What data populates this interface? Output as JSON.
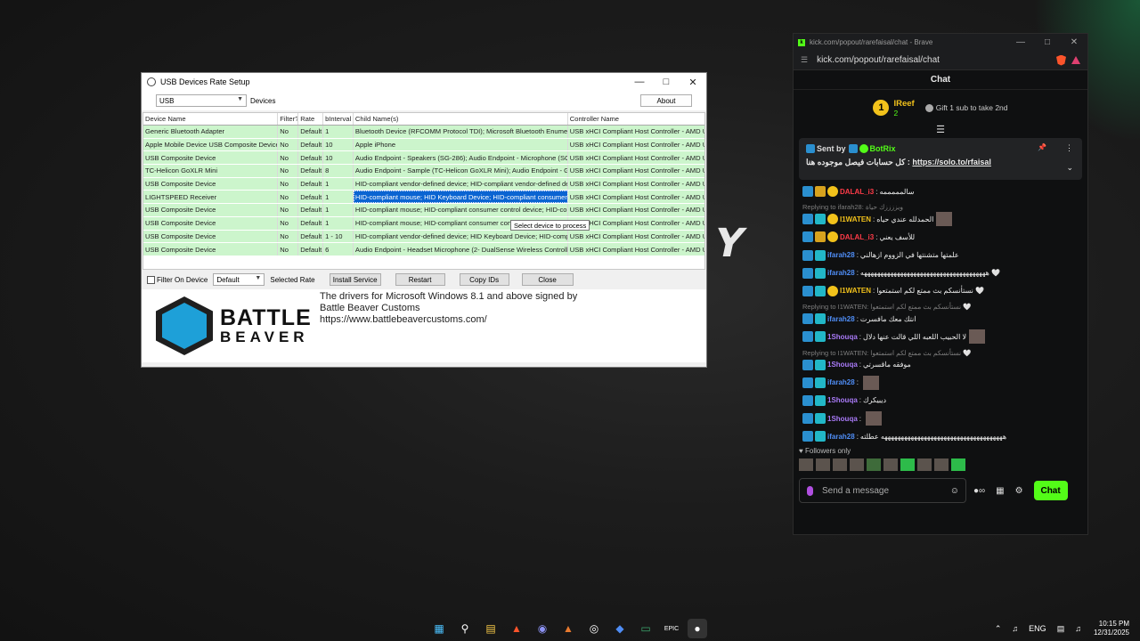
{
  "desktop": {
    "logo_char": "Y"
  },
  "usb": {
    "title": "USB Devices Rate Setup",
    "filter_select": "USB",
    "devices_label": "Devices",
    "about_label": "About",
    "columns": [
      "Device Name",
      "Filter?",
      "Rate",
      "bInterval",
      "Child Name(s)",
      "Controller Name"
    ],
    "rows": [
      [
        "Generic Bluetooth Adapter",
        "No",
        "Default",
        "1",
        "Bluetooth Device (RFCOMM Protocol TDI); Microsoft Bluetooth Enumerator;",
        "USB xHCI Compliant Host Controller - AMD USB"
      ],
      [
        "Apple Mobile Device USB Composite Device",
        "No",
        "Default",
        "10",
        "Apple iPhone",
        "USB xHCI Compliant Host Controller - AMD USB"
      ],
      [
        "USB Composite Device",
        "No",
        "Default",
        "10",
        "Audio Endpoint - Speakers (SG-286); Audio Endpoint - Microphone (SG-286)",
        "USB xHCI Compliant Host Controller - AMD USB"
      ],
      [
        "TC-Helicon GoXLR Mini",
        "No",
        "Default",
        "8",
        "Audio Endpoint - Sample (TC-Helicon GoXLR Mini); Audio Endpoint - Game (",
        "USB xHCI Compliant Host Controller - AMD USB"
      ],
      [
        "USB Composite Device",
        "No",
        "Default",
        "1",
        "HID-compliant vendor-defined device; HID-compliant vendor-defined device; HID-compliant",
        "USB xHCI Compliant Host Controller - AMD USB"
      ],
      [
        "LIGHTSPEED Receiver",
        "No",
        "Default",
        "1",
        "HID-compliant mouse; HID Keyboard Device; HID-compliant consumer cont",
        "USB xHCI Compliant Host Controller - AMD USB"
      ],
      [
        "USB Composite Device",
        "No",
        "Default",
        "1",
        "HID-compliant mouse; HID-compliant consumer control device; HID-complia",
        "USB xHCI Compliant Host Controller - AMD USB"
      ],
      [
        "USB Composite Device",
        "No",
        "Default",
        "1",
        "HID-compliant mouse; HID-compliant consumer control",
        "USB xHCI Compliant Host Controller - AMD USB"
      ],
      [
        "USB Composite Device",
        "No",
        "Default",
        "1 - 10",
        "HID-compliant vendor-defined device; HID Keyboard Device; HID-compliant",
        "USB xHCI Compliant Host Controller - AMD USB"
      ],
      [
        "USB Composite Device",
        "No",
        "Default",
        "6",
        "Audio Endpoint - Headset Microphone (2- DualSense Wireless Controller); Au",
        "USB xHCI Compliant Host Controller - AMD USB"
      ]
    ],
    "selected_row": 5,
    "tooltip": "Select device to process",
    "filter_on_device": "Filter On Device",
    "rate_select": "Default",
    "selected_rate_label": "Selected Rate",
    "buttons": {
      "install": "Install Service",
      "restart": "Restart",
      "copy": "Copy IDs",
      "close": "Close"
    },
    "logo_line1": "BATTLE",
    "logo_line2": "BEAVER",
    "desc1": "The drivers for Microsoft Windows 8.1 and above signed by",
    "desc2": "Battle Beaver Customs",
    "desc3": "https://www.battlebeavercustoms.com/"
  },
  "kick": {
    "window_title": "kick.com/popout/rarefaisal/chat - Brave",
    "url": "kick.com/popout/rarefaisal/chat",
    "chat_header": "Chat",
    "top_gifter": {
      "rank": "1",
      "name": "IReef",
      "count": "2"
    },
    "gift_note": "Gift 1 sub to take 2nd",
    "pinned": {
      "sent_by": "Sent by",
      "bot": "BotRix",
      "text": "كل حسابات فيصل موجوده هنا :",
      "link": "https://solo.to/rfaisal"
    },
    "messages": [
      {
        "reply": "",
        "user": "DALAL_i3",
        "color": "red",
        "text": "سالمممممه"
      },
      {
        "reply": "Replying to ifarah28: ويززززك حياة",
        "user": "I1WATEN",
        "color": "gold",
        "text": "الحمدلله عندي حياه"
      },
      {
        "reply": "",
        "user": "DALAL_i3",
        "color": "red",
        "text": "للأسف يعني"
      },
      {
        "reply": "",
        "user": "ifarah28",
        "color": "blue",
        "text": "علمتها متشنتها في الزووم ازهالني"
      },
      {
        "reply": "",
        "user": "ifarah28",
        "color": "blue",
        "text": "ههههههههههههههههههههههههههههههههههههههه 🤍"
      },
      {
        "reply": "",
        "user": "I1WATEN",
        "color": "gold",
        "text": "نستأنسكم بث ممتع لكم استمتعوا 🤍"
      },
      {
        "reply": "Replying to I1WATEN: نستأنسكم بث ممتع لكم استمتعوا 🤍",
        "user": "ifarah28",
        "color": "blue",
        "text": "انتك معك مافسرت"
      },
      {
        "reply": "",
        "user": "1Shouqa",
        "color": "purple",
        "text": "لا الحبيب اللعبه اللي قالت عنها دلال"
      },
      {
        "reply": "Replying to I1WATEN: نستأنسكم بث ممتع لكم استمتعوا 🤍",
        "user": "1Shouqa",
        "color": "purple",
        "text": "موفقه ماقسرتي"
      },
      {
        "reply": "",
        "user": "ifarah28",
        "color": "blue",
        "text": ""
      },
      {
        "reply": "",
        "user": "1Shouqa",
        "color": "purple",
        "text": "ديبيكرك"
      },
      {
        "reply": "",
        "user": "1Shouqa",
        "color": "purple",
        "text": ""
      },
      {
        "reply": "",
        "user": "ifarah28",
        "color": "blue",
        "text": "هههههههههههههههههههههههههههههههههههههه عطلته"
      }
    ],
    "followers_only": "Followers only",
    "placeholder": "Send a message",
    "chat_button": "Chat"
  },
  "taskbar": {
    "lang": "ENG",
    "time": "10:15 PM",
    "date": "12/31/2025"
  }
}
